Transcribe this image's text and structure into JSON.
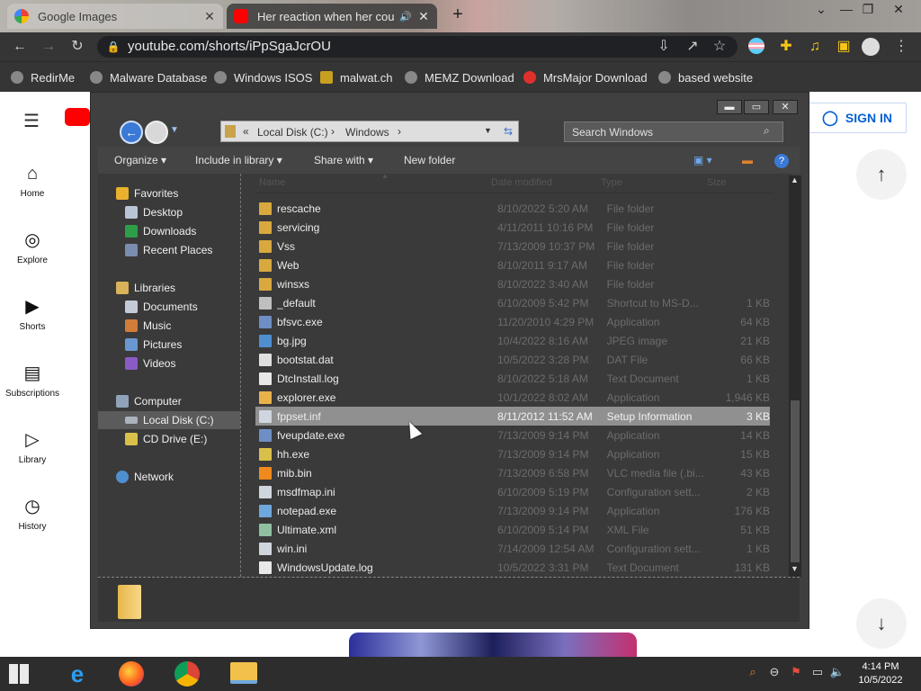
{
  "browser": {
    "tabs": [
      {
        "title": "Google Images",
        "active": false
      },
      {
        "title": "Her reaction when her cousi",
        "active": true
      }
    ],
    "url": "youtube.com/shorts/iPpSgaJcrOU",
    "bookmarks": [
      "RedirMe",
      "Malware Database",
      "Windows ISOS",
      "malwat.ch",
      "MEMZ Download",
      "MrsMajor Download",
      "based website"
    ]
  },
  "youtube": {
    "nav": [
      {
        "label": "Home",
        "icon": "home-icon"
      },
      {
        "label": "Explore",
        "icon": "compass-icon"
      },
      {
        "label": "Shorts",
        "icon": "shorts-icon"
      },
      {
        "label": "Subscriptions",
        "icon": "subscriptions-icon"
      },
      {
        "label": "Library",
        "icon": "library-icon"
      },
      {
        "label": "History",
        "icon": "history-icon"
      }
    ],
    "sign_in": "SIGN IN"
  },
  "explorer": {
    "address": {
      "root": "Local Disk (C:)",
      "folder": "Windows"
    },
    "search_placeholder": "Search Windows",
    "commands": [
      "Organize",
      "Include in library",
      "Share with",
      "New folder"
    ],
    "columns": [
      "Name",
      "Date modified",
      "Type",
      "Size"
    ],
    "nav": {
      "favorites": "Favorites",
      "favorite_items": [
        "Desktop",
        "Downloads",
        "Recent Places"
      ],
      "libraries": "Libraries",
      "library_items": [
        "Documents",
        "Music",
        "Pictures",
        "Videos"
      ],
      "computer": "Computer",
      "computer_items": [
        "Local Disk (C:)",
        "CD Drive (E:)"
      ],
      "network": "Network"
    },
    "files": [
      {
        "name": "rescache",
        "date": "8/10/2022 5:20 AM",
        "type": "File folder",
        "size": "",
        "kind": "folder"
      },
      {
        "name": "servicing",
        "date": "4/11/2011 10:16 PM",
        "type": "File folder",
        "size": "",
        "kind": "folder"
      },
      {
        "name": "Vss",
        "date": "7/13/2009 10:37 PM",
        "type": "File folder",
        "size": "",
        "kind": "folder"
      },
      {
        "name": "Web",
        "date": "8/10/2011 9:17 AM",
        "type": "File folder",
        "size": "",
        "kind": "folder"
      },
      {
        "name": "winsxs",
        "date": "8/10/2022 3:40 AM",
        "type": "File folder",
        "size": "",
        "kind": "folder"
      },
      {
        "name": "_default",
        "date": "6/10/2009 5:42 PM",
        "type": "Shortcut to MS-D...",
        "size": "1 KB",
        "kind": "shortcut"
      },
      {
        "name": "bfsvc.exe",
        "date": "11/20/2010 4:29 PM",
        "type": "Application",
        "size": "64 KB",
        "kind": "app"
      },
      {
        "name": "bg.jpg",
        "date": "10/4/2022 8:16 AM",
        "type": "JPEG image",
        "size": "21 KB",
        "kind": "image"
      },
      {
        "name": "bootstat.dat",
        "date": "10/5/2022 3:28 PM",
        "type": "DAT File",
        "size": "66 KB",
        "kind": "dat"
      },
      {
        "name": "DtcInstall.log",
        "date": "8/10/2022 5:18 AM",
        "type": "Text Document",
        "size": "1 KB",
        "kind": "text"
      },
      {
        "name": "explorer.exe",
        "date": "10/1/2022 8:02 AM",
        "type": "Application",
        "size": "1,946 KB",
        "kind": "explorer"
      },
      {
        "name": "fppset.inf",
        "date": "8/11/2012 11:52 AM",
        "type": "Setup Information",
        "size": "3 KB",
        "kind": "inf",
        "selected": true
      },
      {
        "name": "fveupdate.exe",
        "date": "7/13/2009 9:14 PM",
        "type": "Application",
        "size": "14 KB",
        "kind": "app"
      },
      {
        "name": "hh.exe",
        "date": "7/13/2009 9:14 PM",
        "type": "Application",
        "size": "15 KB",
        "kind": "help"
      },
      {
        "name": "mib.bin",
        "date": "7/13/2009 6:58 PM",
        "type": "VLC media file (.bi...",
        "size": "43 KB",
        "kind": "vlc"
      },
      {
        "name": "msdfmap.ini",
        "date": "6/10/2009 5:19 PM",
        "type": "Configuration sett...",
        "size": "2 KB",
        "kind": "ini"
      },
      {
        "name": "notepad.exe",
        "date": "7/13/2009 9:14 PM",
        "type": "Application",
        "size": "176 KB",
        "kind": "notepad"
      },
      {
        "name": "Ultimate.xml",
        "date": "6/10/2009 5:14 PM",
        "type": "XML File",
        "size": "51 KB",
        "kind": "xml"
      },
      {
        "name": "win.ini",
        "date": "7/14/2009 12:54 AM",
        "type": "Configuration sett...",
        "size": "1 KB",
        "kind": "ini"
      },
      {
        "name": "WindowsUpdate.log",
        "date": "10/5/2022 3:31 PM",
        "type": "Text Document",
        "size": "131 KB",
        "kind": "text"
      }
    ]
  },
  "taskbar": {
    "time": "4:14 PM",
    "date": "10/5/2022",
    "apps": [
      "start-icon",
      "internet-explorer-icon",
      "firefox-icon",
      "chrome-icon",
      "file-explorer-icon"
    ]
  },
  "colors": {
    "youtube_red": "#ff0000",
    "signin_blue": "#065fd4",
    "bookmark_heart": "#e0302c"
  }
}
